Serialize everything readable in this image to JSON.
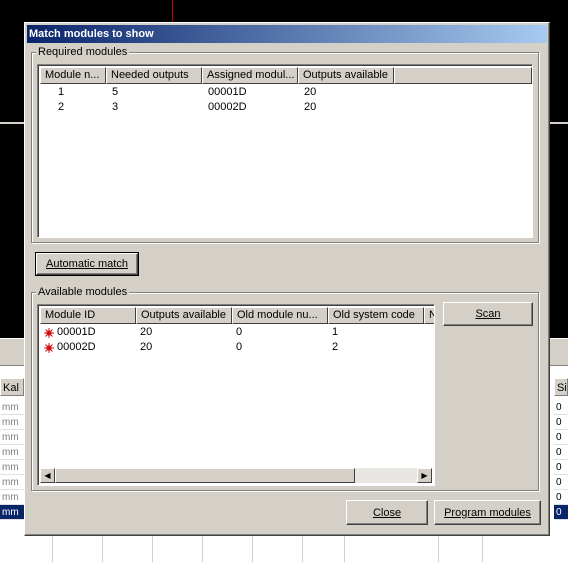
{
  "background": {
    "left_col_header": "Kal",
    "right_col_header": "Si",
    "units": [
      "mm",
      "mm",
      "mm",
      "mm",
      "mm",
      "mm",
      "mm",
      "mm"
    ],
    "right_values": [
      "0",
      "0",
      "0",
      "0",
      "0",
      "0",
      "0",
      "0"
    ]
  },
  "dialog": {
    "title": "Match modules to show",
    "required": {
      "group_label": "Required modules",
      "columns": [
        "Module n...",
        "Needed outputs",
        "Assigned modul...",
        "Outputs available"
      ],
      "rows": [
        {
          "module_no": "1",
          "needed": "5",
          "assigned": "00001D",
          "available": "20"
        },
        {
          "module_no": "2",
          "needed": "3",
          "assigned": "00002D",
          "available": "20"
        }
      ]
    },
    "automatic_match_label": "Automatic match",
    "available": {
      "group_label": "Available modules",
      "columns": [
        "Module ID",
        "Outputs available",
        "Old module nu...",
        "Old system code",
        "N"
      ],
      "rows": [
        {
          "id": "00001D",
          "outputs": "20",
          "old_module": "0",
          "old_system": "1"
        },
        {
          "id": "00002D",
          "outputs": "20",
          "old_module": "0",
          "old_system": "2"
        }
      ],
      "icon": "module-status-icon"
    },
    "scan_label": "Scan",
    "close_label": "Close",
    "program_label": "Program modules"
  }
}
